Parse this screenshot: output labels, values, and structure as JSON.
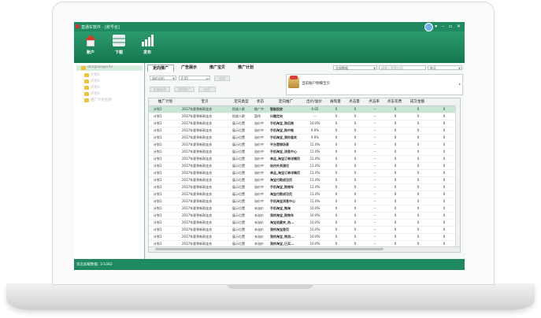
{
  "window": {
    "title": "直通车软件 - [账号名]"
  },
  "toolbar": {
    "items": [
      {
        "label": "账户",
        "icon": "home-icon"
      },
      {
        "label": "下载",
        "icon": "download-icon"
      },
      {
        "label": "发布",
        "icon": "publish-icon"
      }
    ]
  },
  "sidebar": {
    "items": [
      "dongsangerliu",
      "计划1",
      "计划2",
      "计划3",
      "计划4",
      "推广计划名称"
    ]
  },
  "tabs": [
    "定向推广",
    "广告展示",
    "推广宝贝",
    "推广计划"
  ],
  "filter": {
    "data_select": "全部数据",
    "search_placeholder": "请输入搜索内容",
    "date_select": "昨天",
    "bid_select": "溢价出价",
    "bid_value": "0.05",
    "apply_button": "应用",
    "btn_batch": "批量修改",
    "btn_pause": "暂停推广",
    "btn_start": "启用"
  },
  "info": {
    "text": "当前账户明细宝贝"
  },
  "table": {
    "headers": [
      "推广计划",
      "宝贝",
      "定向类型",
      "状态",
      "定向推广",
      "出价/溢价",
      "展现量",
      "点击量",
      "点击率",
      "点击花费",
      "成交金额",
      ""
    ],
    "rows": [
      [
        "计划1",
        "2017年夏季新款连衣",
        "投放人群",
        "推广中",
        "智能投放",
        "0.05",
        "0",
        "0",
        "--",
        "0",
        "0",
        "0"
      ],
      [
        "计划1",
        "2017年夏季新款连衣",
        "投放人群",
        "暂停",
        "兴趣定向",
        "--",
        "0",
        "0",
        "--",
        "0",
        "0",
        "0"
      ],
      [
        "计划1",
        "2017年夏季新款连衣",
        "展示位置",
        "溢价中",
        "手机淘宝_购后推",
        "10.0%",
        "0",
        "0",
        "--",
        "0",
        "0",
        "0"
      ],
      [
        "计划1",
        "2017年夏季新款连衣",
        "展示位置",
        "溢价中",
        "手机淘宝_购中推",
        "9.0%",
        "0",
        "0",
        "--",
        "0",
        "0",
        "0"
      ],
      [
        "计划1",
        "2017年夏季新款连衣",
        "展示位置",
        "溢价中",
        "手机淘宝_猜你喜欢",
        "9.0%",
        "0",
        "0",
        "--",
        "0",
        "0",
        "0"
      ],
      [
        "计划1",
        "2017年夏季新款连衣",
        "展示位置",
        "溢价中",
        "平台营销场景",
        "11.0%",
        "0",
        "0",
        "--",
        "0",
        "0",
        "0"
      ],
      [
        "计划1",
        "2017年夏季新款连衣",
        "展示位置",
        "溢价中",
        "手机淘宝_消息中心",
        "11.0%",
        "0",
        "0",
        "--",
        "0",
        "0",
        "0"
      ],
      [
        "计划1",
        "2017年夏季新款连衣",
        "展示位置",
        "溢价中",
        "单品_淘宝订单详情页",
        "11.0%",
        "0",
        "0",
        "--",
        "0",
        "0",
        "0"
      ],
      [
        "计划1",
        "2017年夏季新款连衣",
        "展示位置",
        "溢价中",
        "站内外资源位",
        "11.0%",
        "0",
        "0",
        "--",
        "0",
        "0",
        "0"
      ],
      [
        "计划1",
        "2017年夏季新款连衣",
        "展示位置",
        "溢价中",
        "单品_淘宝订单详情页",
        "11.0%",
        "0",
        "0",
        "--",
        "0",
        "0",
        "0"
      ],
      [
        "计划1",
        "2017年夏季新款连衣",
        "展示位置",
        "溢价中",
        "淘宝付款成功页",
        "11.0%",
        "0",
        "0",
        "--",
        "0",
        "0",
        "0"
      ],
      [
        "计划1",
        "2017年夏季新款连衣",
        "展示位置",
        "溢价中",
        "手机淘宝_购物车",
        "11.0%",
        "0",
        "0",
        "--",
        "0",
        "0",
        "0"
      ],
      [
        "计划1",
        "2017年夏季新款连衣",
        "展示位置",
        "溢价中",
        "淘宝付款成功页",
        "11.0%",
        "0",
        "0",
        "--",
        "0",
        "0",
        "0"
      ],
      [
        "计划1",
        "2017年夏季新款连衣",
        "展示位置",
        "溢价中",
        "手机淘宝消息中心",
        "11.0%",
        "0",
        "0",
        "--",
        "0",
        "0",
        "0"
      ],
      [
        "计划1",
        "2017年夏季新款连衣",
        "展示位置",
        "未溢价",
        "手机淘宝_微淘",
        "10.0%",
        "0",
        "0",
        "--",
        "0",
        "0",
        "0"
      ],
      [
        "计划1",
        "2017年夏季新款连衣",
        "展示位置",
        "未溢价",
        "我的淘宝_购物车",
        "10.0%",
        "0",
        "0",
        "--",
        "0",
        "0",
        "0"
      ],
      [
        "计划1",
        "2017年夏季新款连衣",
        "展示位置",
        "未溢价",
        "淘宝收藏夹_热...",
        "10.0%",
        "0",
        "0",
        "--",
        "0",
        "0",
        "0"
      ],
      [
        "计划1",
        "2017年夏季新款连衣",
        "展示位置",
        "未溢价",
        "我的淘宝首页",
        "10.0%",
        "0",
        "0",
        "--",
        "0",
        "0",
        "0"
      ],
      [
        "计划1",
        "2017年夏季新款连衣",
        "展示位置",
        "未溢价",
        "我的淘宝_物流...",
        "10.0%",
        "0",
        "0",
        "--",
        "0",
        "0",
        "0"
      ],
      [
        "计划1",
        "2017年夏季新款连衣",
        "展示位置",
        "未溢价",
        "我的淘宝_已买...",
        "10.0%",
        "0",
        "0",
        "--",
        "0",
        "0",
        "0"
      ]
    ]
  },
  "status": {
    "text": "状态加载数据: 1/1082"
  }
}
